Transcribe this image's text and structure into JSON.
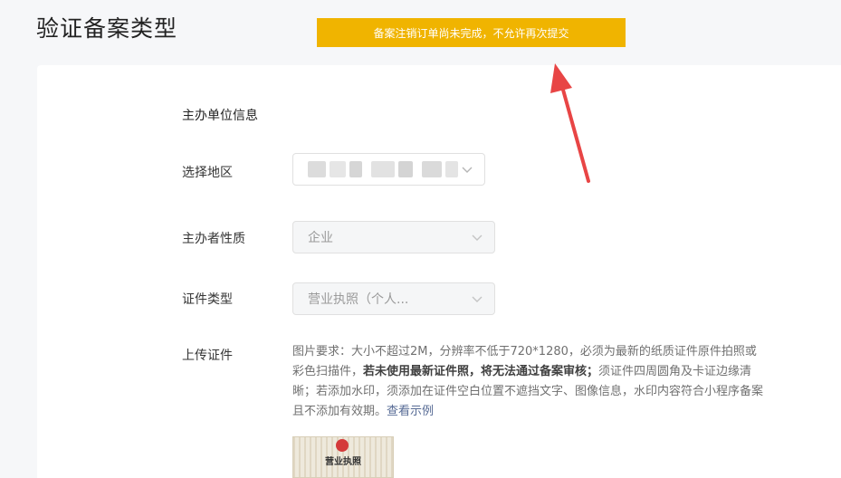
{
  "header": {
    "title": "验证备案类型"
  },
  "toast": {
    "message": "备案注销订单尚未完成，不允许再次提交",
    "color": "#f0b400"
  },
  "form": {
    "section_title": "主办单位信息",
    "region": {
      "label": "选择地区",
      "value_redacted": true
    },
    "organizer_type": {
      "label": "主办者性质",
      "value": "企业"
    },
    "certificate_type": {
      "label": "证件类型",
      "value": "营业执照（个人..."
    },
    "upload": {
      "label": "上传证件",
      "desc_part1": "图片要求：大小不超过2M，分辨率不低于720*1280，必须为最新的纸质证件原件拍照或彩色扫描件，",
      "desc_bold": "若未使用最新证件照，将无法通过备案审核；",
      "desc_part2": "须证件四周圆角及卡证边缘清晰；若添加水印，须添加在证件空白位置不遮挡文字、图像信息，水印内容符合小程序备案且不添加有效期。",
      "example_link": "查看示例",
      "sample_title": "营业执照"
    }
  },
  "icons": {
    "dropdown": "chevron-down-icon",
    "annotation": "red-arrow-icon"
  }
}
